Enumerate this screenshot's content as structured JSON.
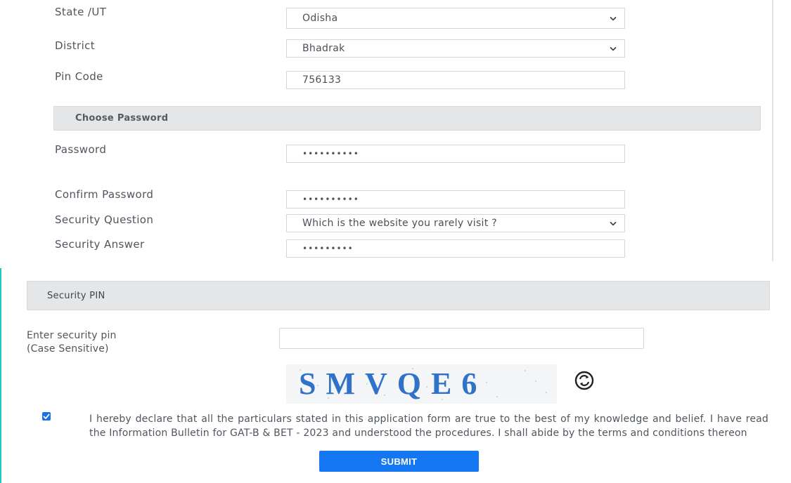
{
  "address": {
    "state_label": "State /UT",
    "state_value": "Odisha",
    "district_label": "District",
    "district_value": "Bhadrak",
    "pin_label": "Pin Code",
    "pin_value": "756133"
  },
  "password_section": {
    "title": "Choose Password",
    "password_label": "Password",
    "password_value": "••••••••••",
    "confirm_label": "Confirm Password",
    "confirm_value": "••••••••••",
    "question_label": "Security Question",
    "question_value": "Which is the website you rarely visit ?",
    "answer_label": "Security Answer",
    "answer_value": "•••••••••"
  },
  "security_pin": {
    "title": "Security PIN",
    "enter_label_line1": "Enter security pin",
    "enter_label_line2": "(Case Sensitive)",
    "pin_input_value": "",
    "captcha_text": "SMVQE6"
  },
  "declaration": {
    "checked": true,
    "text": "I hereby declare that all the particulars stated in this application form are true to the best of my knowledge and belief. I have read the Information Bulletin for GAT-B & BET - 2023 and understood the procedures. I shall abide by the terms and conditions thereon"
  },
  "actions": {
    "submit_label": "SUBMIT"
  },
  "colors": {
    "accent": "#1677f2",
    "section_band": "#e5e6e7",
    "left_border": "#21c3cf"
  },
  "icons": {
    "select": "chevron-down-icon",
    "refresh": "refresh-icon",
    "checkbox": "check-icon"
  }
}
